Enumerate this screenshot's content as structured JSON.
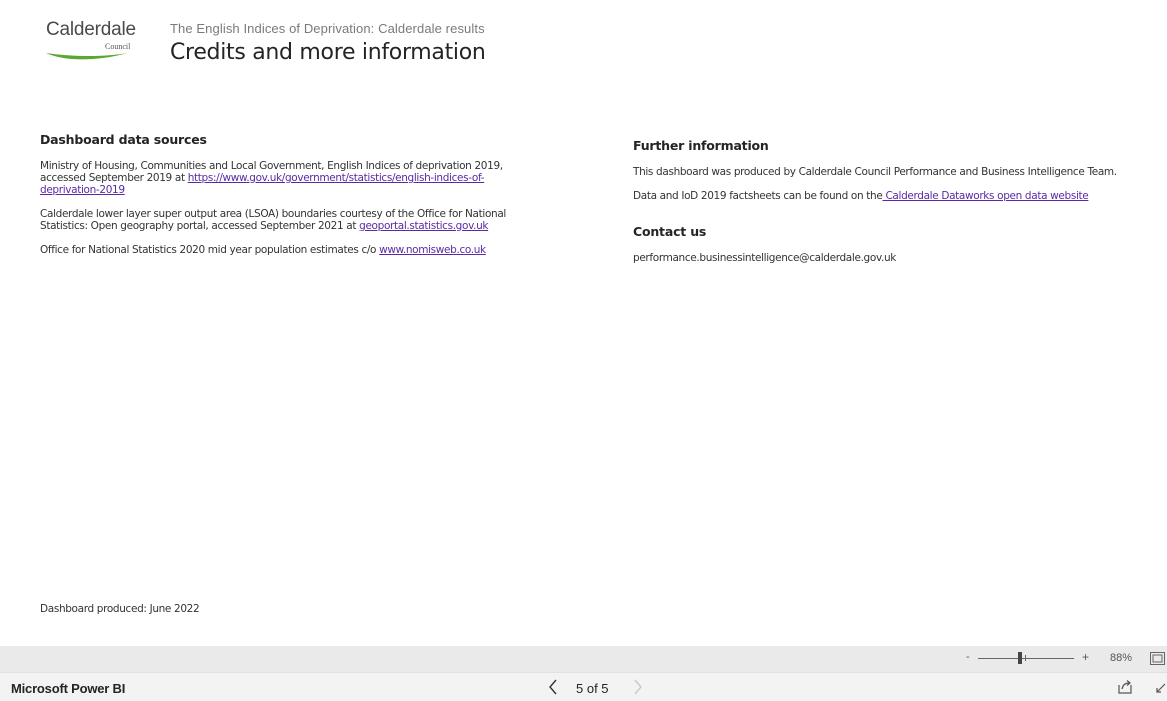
{
  "header": {
    "logo_text": "Calderdale",
    "logo_subtext": "Council",
    "subtitle": "The English Indices of Deprivation: Calderdale results",
    "title": "Credits and more information"
  },
  "sources": {
    "heading": "Dashboard data sources",
    "p1_text": "Ministry of Housing, Communities and Local Government, English Indices of deprivation 2019, accessed September 2019 at ",
    "p1_link": "https://www.gov.uk/government/statistics/english-indices-of-deprivation-2019",
    "p2_text": "Calderdale lower layer super output area (LSOA) boundaries courtesy of the Office for National Statistics: Open geography portal, accessed September 2021 at ",
    "p2_link": "geoportal.statistics.gov.uk",
    "p3_text": "Office for National Statistics 2020 mid year population estimates c/o ",
    "p3_link": "www.nomisweb.co.uk"
  },
  "further": {
    "heading": "Further information",
    "p1": "This dashboard was produced by Calderdale Council Performance and Business Intelligence Team.",
    "p2_text": "Data and IoD 2019 factsheets can be found on the",
    "p2_link": " Calderdale Dataworks open data website"
  },
  "contact": {
    "heading": "Contact us",
    "email": "performance.businessintelligence@calderdale.gov.uk"
  },
  "produced": "Dashboard produced: June 2022",
  "zoom": {
    "minus": "-",
    "plus": "+",
    "level": "88%",
    "value_percent": 88
  },
  "footer": {
    "brand": "Microsoft Power BI",
    "page_indicator": "5 of 5"
  },
  "colors": {
    "link": "#5a2aa6",
    "logo_green": "#5aa832"
  }
}
